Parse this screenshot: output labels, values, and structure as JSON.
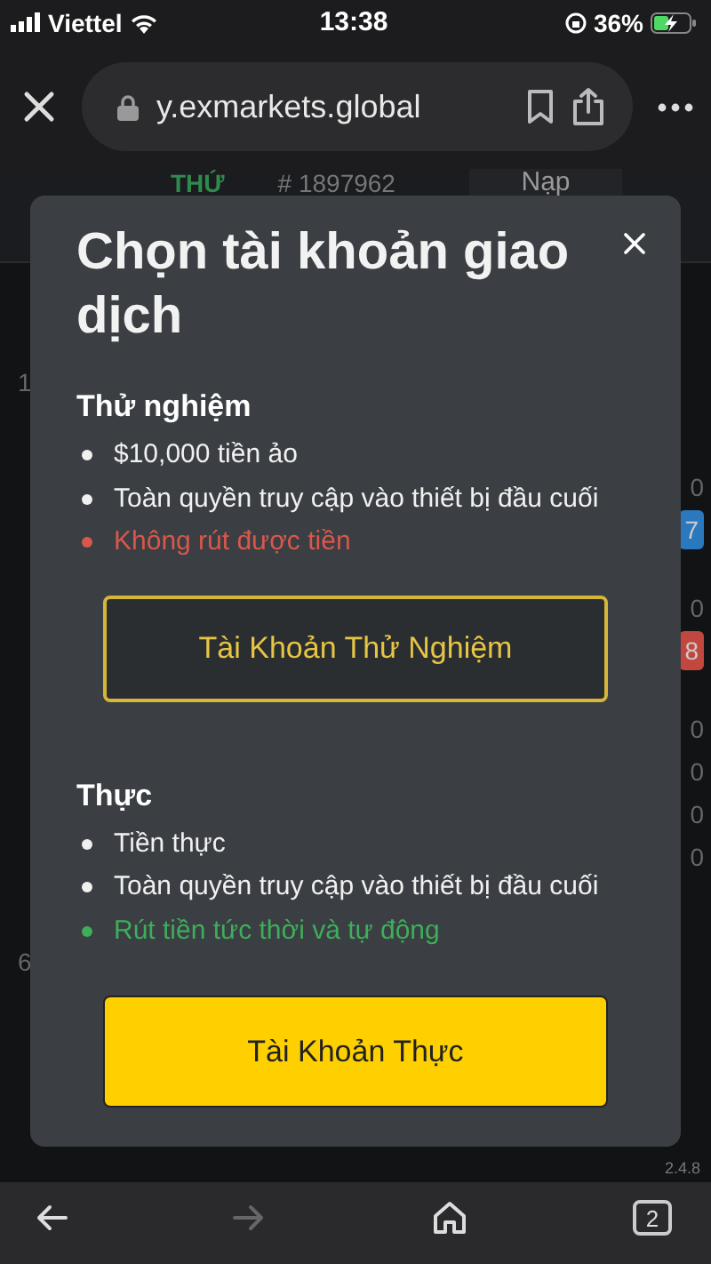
{
  "status_bar": {
    "carrier": "Viettel",
    "time": "13:38",
    "battery": "36%"
  },
  "browser": {
    "url": "y.exmarkets.global"
  },
  "background": {
    "account_type": "THỨ",
    "account_number": "# 1897962",
    "deposit_button": "Nạp",
    "left_values": [
      "1",
      "6"
    ],
    "right_values": [
      {
        "text": "0"
      },
      {
        "text": "7",
        "color": "#2a78bd"
      },
      {
        "text": "0"
      },
      {
        "text": "8",
        "color": "#c2473f"
      },
      {
        "text": "0"
      },
      {
        "text": "0"
      },
      {
        "text": "0"
      },
      {
        "text": "0"
      }
    ],
    "version": "2.4.8"
  },
  "modal": {
    "title": "Chọn tài khoản giao dịch",
    "sections": [
      {
        "heading": "Thử nghiệm",
        "features": [
          {
            "text": "$10,000 tiền ảo",
            "kind": "neutral"
          },
          {
            "text": "Toàn quyền truy cập vào thiết bị đầu cuối",
            "kind": "neutral"
          },
          {
            "text": "Không rút được tiền",
            "kind": "negative"
          }
        ],
        "button": {
          "label": "Tài Khoản Thử Nghiệm",
          "kind": "outline"
        }
      },
      {
        "heading": "Thực",
        "features": [
          {
            "text": "Tiền thực",
            "kind": "neutral"
          },
          {
            "text": "Toàn quyền truy cập vào thiết bị đầu cuối",
            "kind": "neutral"
          },
          {
            "text": "Rút tiền tức thời và tự động",
            "kind": "positive"
          }
        ],
        "button": {
          "label": "Tài Khoản Thực",
          "kind": "filled"
        }
      }
    ]
  },
  "toolbar": {
    "tab_count": "2"
  }
}
